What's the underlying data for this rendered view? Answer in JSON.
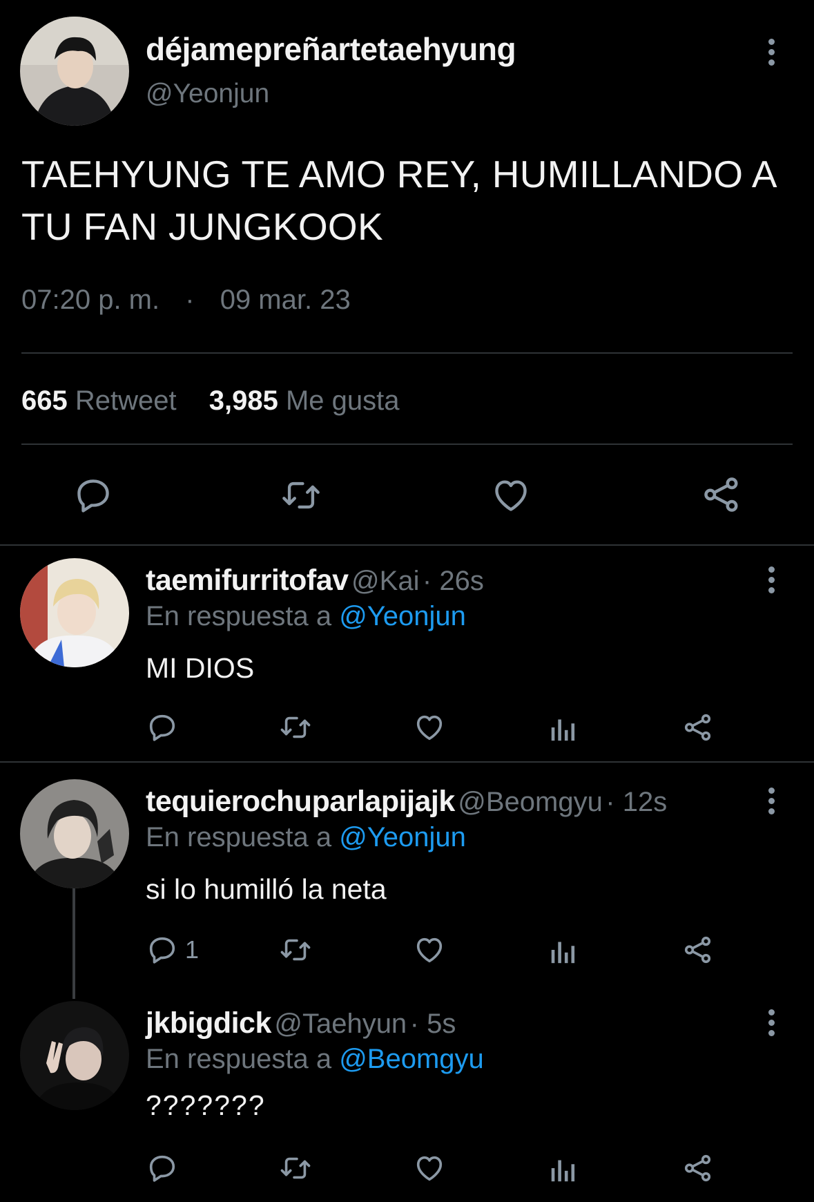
{
  "main_tweet": {
    "display_name": "déjamepreñartetaehyung",
    "handle": "@Yeonjun",
    "text": "TAEHYUNG TE AMO REY, HUMILLANDO A TU FAN JUNGKOOK",
    "time": "07:20 p. m.",
    "separator": "·",
    "date": "09 mar. 23",
    "retweets_count": "665",
    "retweets_label": "Retweet",
    "likes_count": "3,985",
    "likes_label": "Me gusta"
  },
  "replies": [
    {
      "display_name": "taemifurritofav",
      "handle": "@Kai",
      "time": "· 26s",
      "reply_prefix": "En respuesta a",
      "reply_to": "@Yeonjun",
      "text": "MI DIOS",
      "reply_count": ""
    },
    {
      "display_name": "tequierochuparlapijajk",
      "handle": "@Beomgyu",
      "time": "· 12s",
      "reply_prefix": "En respuesta a",
      "reply_to": "@Yeonjun",
      "text": "si lo humilló la neta",
      "reply_count": "1"
    },
    {
      "display_name": "jkbigdick",
      "handle": "@Taehyun",
      "time": "· 5s",
      "reply_prefix": "En respuesta a",
      "reply_to": "@Beomgyu",
      "text": "???????",
      "reply_count": ""
    }
  ],
  "icons": [
    "reply-icon",
    "retweet-icon",
    "like-icon",
    "share-icon",
    "analytics-icon",
    "more-icon"
  ],
  "colors": {
    "background": "#000000",
    "text": "#e7e9ea",
    "muted": "#6e767d",
    "link": "#1d9bf0",
    "divider": "#2f3336"
  }
}
